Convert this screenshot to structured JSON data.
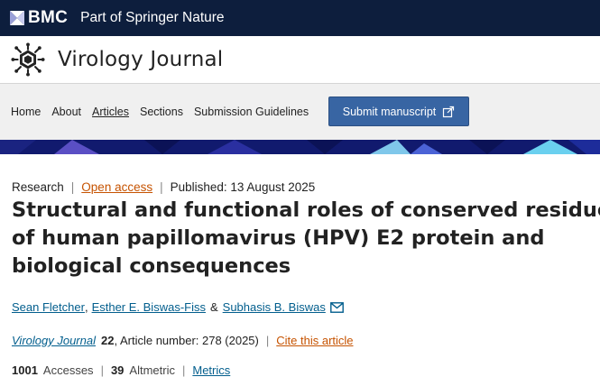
{
  "topbar": {
    "brand": "BMC",
    "part_of": "Part of Springer Nature",
    "icon": "bmc-logo-icon",
    "background": "#0d1e3d"
  },
  "journal": {
    "title": "Virology Journal",
    "logo_icon": "virus-icon"
  },
  "nav": {
    "items": [
      {
        "label": "Home"
      },
      {
        "label": "About"
      },
      {
        "label": "Articles",
        "active": true
      },
      {
        "label": "Sections"
      },
      {
        "label": "Submission Guidelines"
      }
    ],
    "submit_label": "Submit manuscript",
    "submit_icon": "external-link-icon",
    "submit_color": "#3865a3"
  },
  "article": {
    "type": "Research",
    "access": "Open access",
    "published": "Published: 13 August 2025",
    "title_lines": [
      "Structural and functional roles of conserved residues",
      "of human papillomavirus (HPV) E2 protein and",
      "biological consequences"
    ],
    "authors": [
      "Sean Fletcher",
      "Esther E. Biswas-Fiss",
      "Subhasis B. Biswas"
    ],
    "author_sep_1": ",",
    "author_sep_2": "&",
    "mail_icon": "mail-icon",
    "citation": {
      "journal": "Virology Journal",
      "volume": "22",
      "details": ", Article number: 278 (2025)",
      "cite_label": "Cite this article"
    },
    "metrics": {
      "accesses_count": "1001",
      "accesses_label": "Accesses",
      "altmetric_count": "39",
      "altmetric_label": "Altmetric",
      "metrics_label": "Metrics"
    }
  },
  "colors": {
    "link": "#025e8d",
    "accent_orange": "#c65301",
    "band": "#111a6e"
  }
}
